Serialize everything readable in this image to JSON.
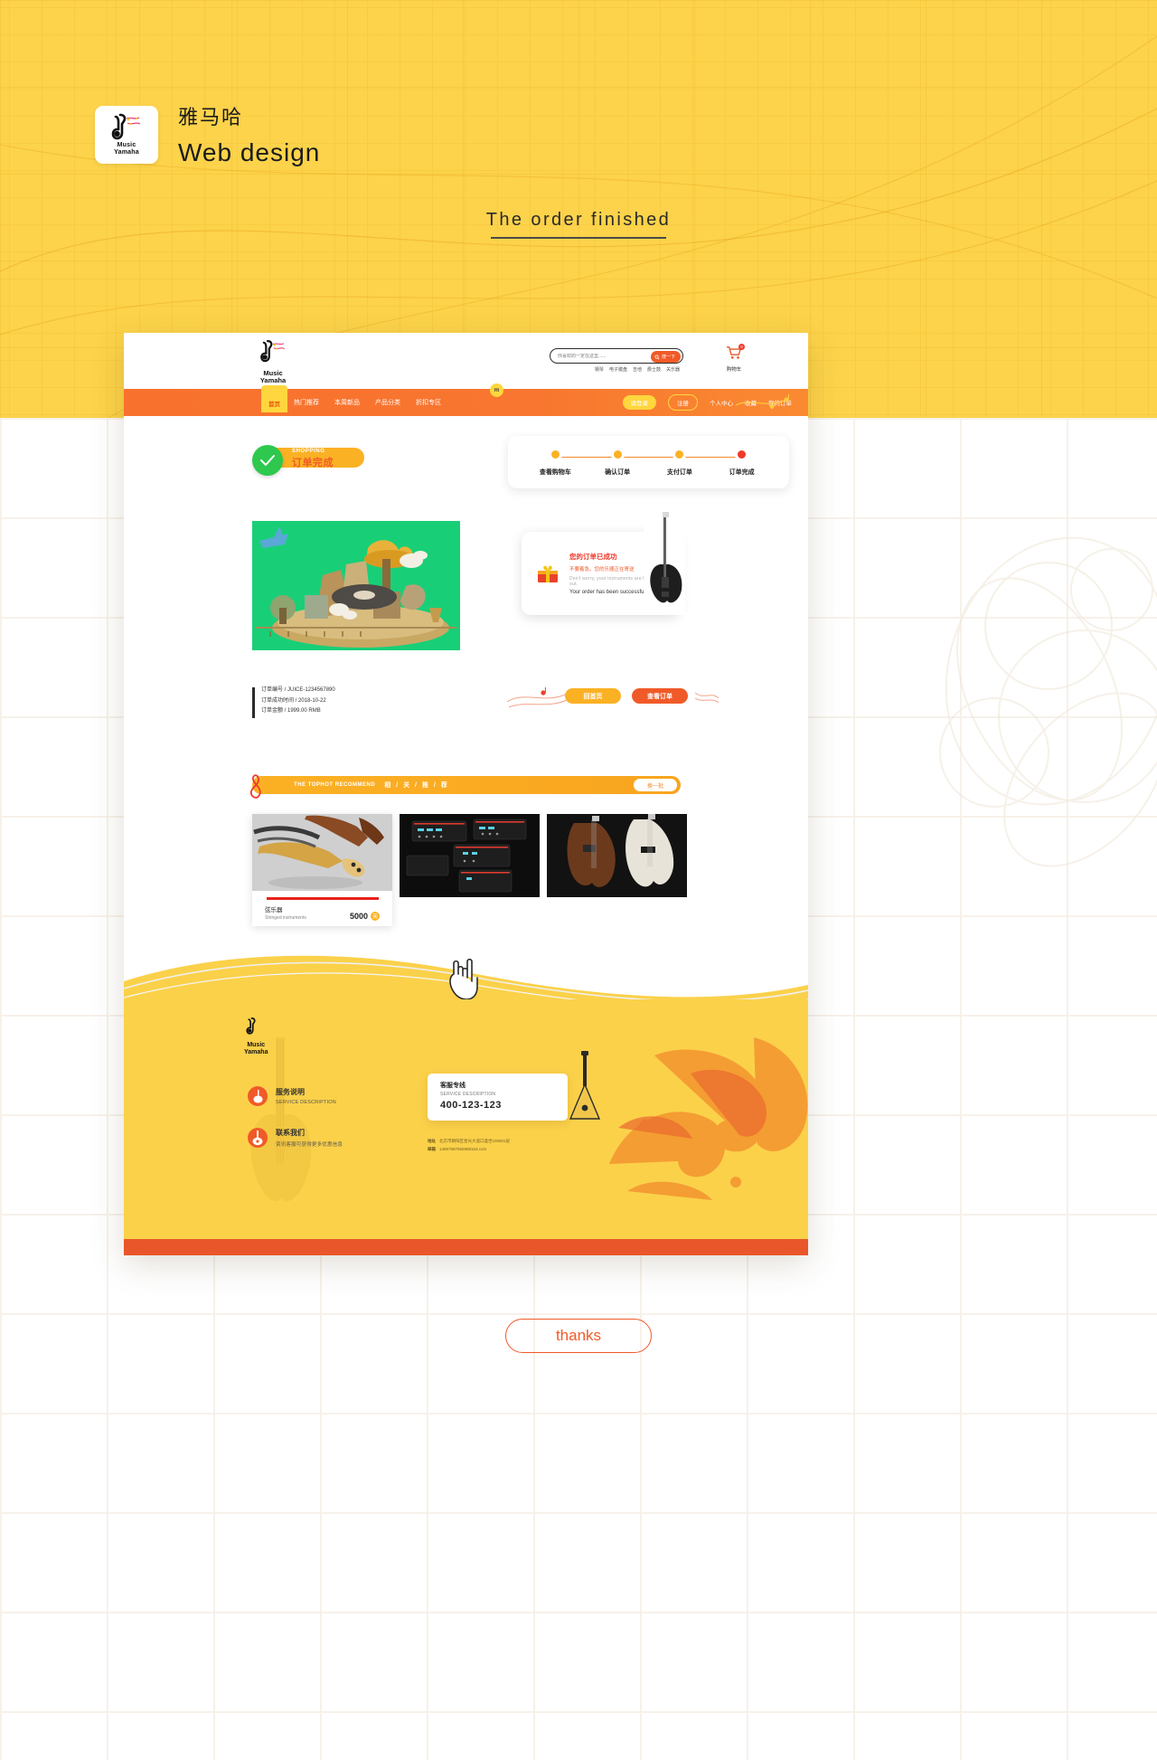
{
  "hero": {
    "brand_cn": "雅马哈",
    "brand_en": "Web design",
    "logo_music": "Music",
    "logo_yamaha": "Yamaha",
    "title": "The order finished",
    "bg_color": "#fcd34a"
  },
  "site": {
    "logo_music": "Music",
    "logo_yamaha": "Yamaha",
    "search": {
      "placeholder": "你喜欢的一定在这里......",
      "button_label": "搜一下",
      "icon": "search-icon",
      "hot_words": [
        "钢琴",
        "电子键盘",
        "吉他",
        "爵士鼓",
        "关乐器"
      ]
    },
    "cart": {
      "label": "购物车",
      "count": "0",
      "icon": "cart-icon"
    },
    "nav": {
      "home": "首页",
      "items": [
        "热门推荐",
        "本周新品",
        "产品分类",
        "折扣专区"
      ],
      "hi_bubble": "Hi",
      "login": "请登录",
      "register": "注册",
      "right_links": [
        "个人中心",
        "收藏",
        "我的订单"
      ]
    }
  },
  "main": {
    "done_badge": {
      "shopping": "SHOPPING",
      "title": "订单完成",
      "icon": "check-icon"
    },
    "stepper": {
      "steps": [
        {
          "label": "查看购物车",
          "color": "#fbb124"
        },
        {
          "label": "确认订单",
          "color": "#fbb124"
        },
        {
          "label": "支付订单",
          "color": "#fbb124"
        },
        {
          "label": "订单完成",
          "color": "#f0392b"
        }
      ]
    },
    "message": {
      "icon": "gift-icon",
      "line1": "您的订单已成功",
      "line2": "不要着急。您的乐器正在寄送",
      "line3": "Don't worry, your instruments are being handed out.",
      "line4": "Your order has been successful"
    },
    "order_info": [
      "订单编号  /  JUICE-1234567890",
      "订单成功时间  /  2018-10-22",
      "订单金额  /  1999.00 RMB"
    ],
    "actions": {
      "home": "回首页",
      "view": "查看订单"
    },
    "recommend": {
      "icon": "treble-clef-icon",
      "en": "THE TOPHOT  RECOMMEND",
      "cn": "相 / 关 / 推 / 荐",
      "change": "换一批"
    },
    "products": [
      {
        "cn": "弦乐器",
        "en": "Stringed instruments",
        "price": "5000",
        "unit": "元"
      },
      {
        "cn": "",
        "en": "",
        "price": "",
        "unit": ""
      },
      {
        "cn": "",
        "en": "",
        "price": "",
        "unit": ""
      }
    ]
  },
  "footer": {
    "logo_music": "Music",
    "logo_yamaha": "Yamaha",
    "items": [
      {
        "icon": "violin-icon",
        "title": "服务说明",
        "sub": "SERVICE DESCRIPTION"
      },
      {
        "icon": "guitar-icon",
        "title": "联系我们",
        "sub": "资讯客服可获得更多优惠信息"
      }
    ],
    "service_card": {
      "title": "客服专线",
      "sub": "SERVICE DESCRIPTION",
      "number": "400-123-123"
    },
    "address_label": "地址",
    "address_value": "北京市朝阳区星光大道口盛世100901层",
    "email_label": "邮箱",
    "email_value": "13967597655998163.com"
  },
  "thanks": "thanks"
}
